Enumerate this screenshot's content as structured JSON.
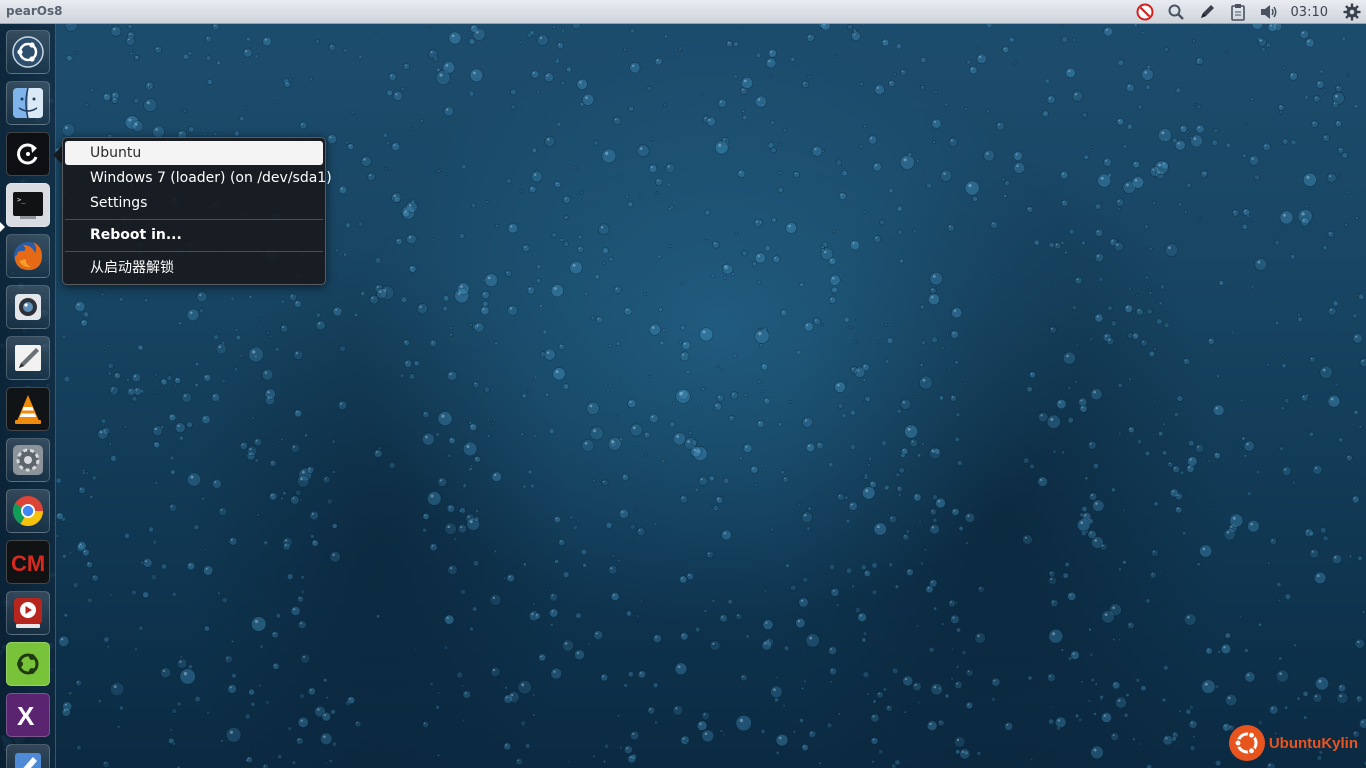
{
  "panel": {
    "app_title": "pearOs8",
    "clock": "03:10",
    "tray_icons": [
      "no-entry-icon",
      "search-icon",
      "pen-icon",
      "clipboard-icon",
      "volume-icon",
      "gear-icon"
    ]
  },
  "launcher": {
    "items": [
      {
        "name": "ubuntu-dash-icon"
      },
      {
        "name": "finder-icon"
      },
      {
        "name": "reboot-launcher-icon"
      },
      {
        "name": "terminal-icon"
      },
      {
        "name": "firefox-icon"
      },
      {
        "name": "webcam-icon"
      },
      {
        "name": "text-editor-icon"
      },
      {
        "name": "vlc-icon"
      },
      {
        "name": "system-settings-icon"
      },
      {
        "name": "chrome-icon"
      },
      {
        "name": "cm-icon"
      },
      {
        "name": "media-player-icon"
      },
      {
        "name": "software-center-icon"
      },
      {
        "name": "x-app-icon"
      },
      {
        "name": "mail-app-icon"
      }
    ]
  },
  "quicklist": {
    "items": [
      {
        "label": "Ubuntu"
      },
      {
        "label": "Windows 7 (loader) (on /dev/sda1)"
      },
      {
        "label": "Settings"
      },
      {
        "label": "Reboot in..."
      },
      {
        "label": "从启动器解锁"
      }
    ]
  },
  "watermark": {
    "text": "UbuntuKylin"
  },
  "colors": {
    "accent": "#e8541e",
    "panel": "#d9dde3",
    "wallpaper": "#174461"
  }
}
